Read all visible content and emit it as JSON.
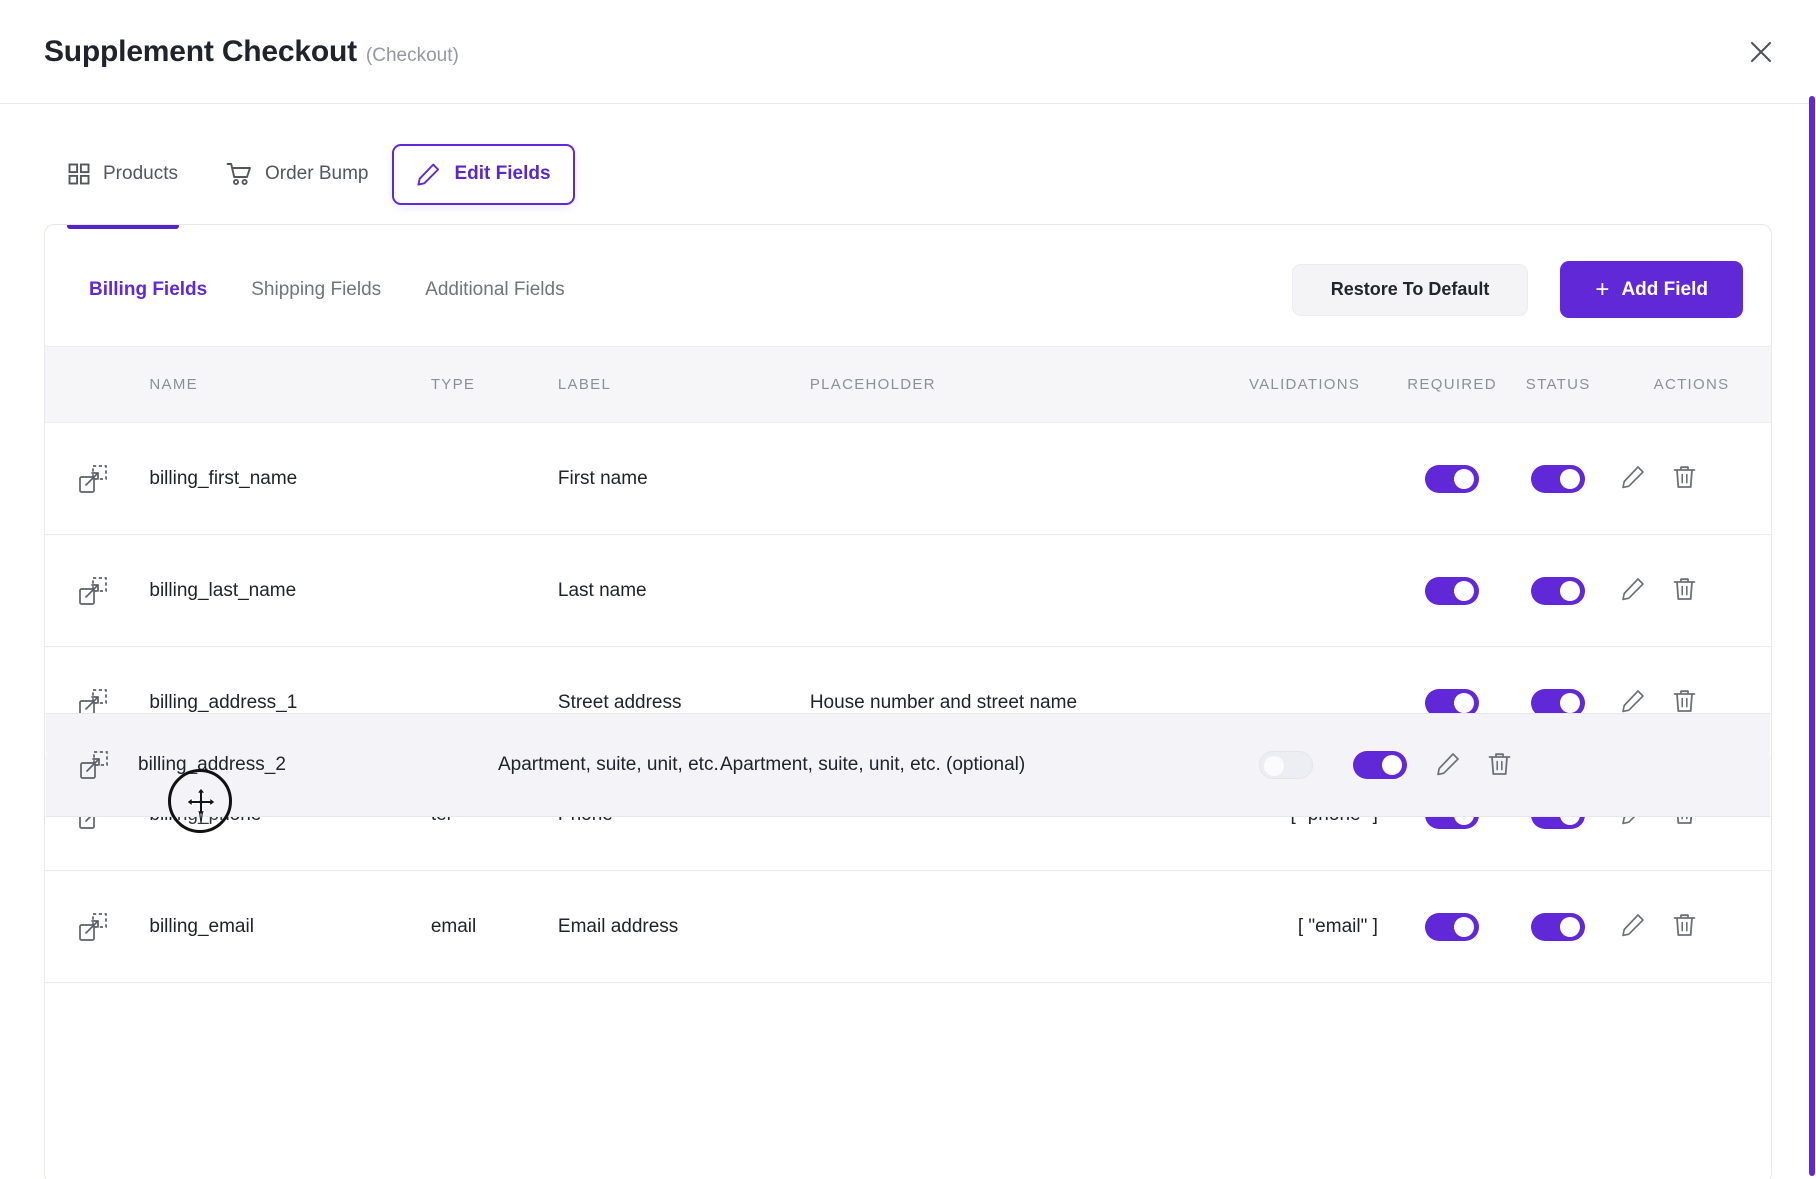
{
  "header": {
    "title": "Supplement Checkout",
    "subtitle": "(Checkout)",
    "close_label": "×"
  },
  "top_tabs": [
    {
      "label": "Products",
      "icon": "grid-icon",
      "active": false
    },
    {
      "label": "Order Bump",
      "icon": "cart-icon",
      "active": false
    },
    {
      "label": "Edit Fields",
      "icon": "pencil-icon",
      "active": true
    }
  ],
  "sub_tabs": [
    {
      "label": "Billing Fields",
      "active": true
    },
    {
      "label": "Shipping Fields",
      "active": false
    },
    {
      "label": "Additional Fields",
      "active": false
    }
  ],
  "toolbar": {
    "restore_label": "Restore To Default",
    "add_field_plus": "+",
    "add_field_label": "Add Field"
  },
  "table": {
    "headers": {
      "name": "NAME",
      "type": "TYPE",
      "label": "LABEL",
      "placeholder": "PLACEHOLDER",
      "validations": "VALIDATIONS",
      "required": "REQUIRED",
      "status": "STATUS",
      "actions": "ACTIONS"
    },
    "rows": [
      {
        "name": "billing_first_name",
        "type": "",
        "label": "First name",
        "placeholder": "",
        "validations": "",
        "required": true,
        "status": true
      },
      {
        "name": "billing_last_name",
        "type": "",
        "label": "Last name",
        "placeholder": "",
        "validations": "",
        "required": true,
        "status": true
      },
      {
        "name": "billing_address_1",
        "type": "",
        "label": "Street address",
        "placeholder": "House number and street name",
        "validations": "",
        "required": true,
        "status": true
      },
      {
        "name": "billing_phone",
        "type": "tel",
        "label": "Phone",
        "placeholder": "",
        "validations": "[ \"phone\" ]",
        "required": true,
        "status": true
      },
      {
        "name": "billing_email",
        "type": "email",
        "label": "Email address",
        "placeholder": "",
        "validations": "[ \"email\" ]",
        "required": true,
        "status": true
      }
    ],
    "dragging_row": {
      "name": "billing_address_2",
      "type": "",
      "label": "Apartment, suite, unit, etc.",
      "placeholder": "Apartment, suite, unit, etc. (optional)",
      "validations": "",
      "required": false,
      "status": true
    }
  },
  "icons": {
    "drag_handle": "drag-move-icon",
    "edit": "pencil-icon",
    "delete": "trash-icon",
    "cursor": "move-cursor-icon"
  },
  "colors": {
    "accent": "#6028d6",
    "accent_dark": "#5326c4",
    "text": "#21232c",
    "muted": "#8c8f9b",
    "row_highlight": "#f3f3f8",
    "header_bg": "#f6f6f9"
  }
}
